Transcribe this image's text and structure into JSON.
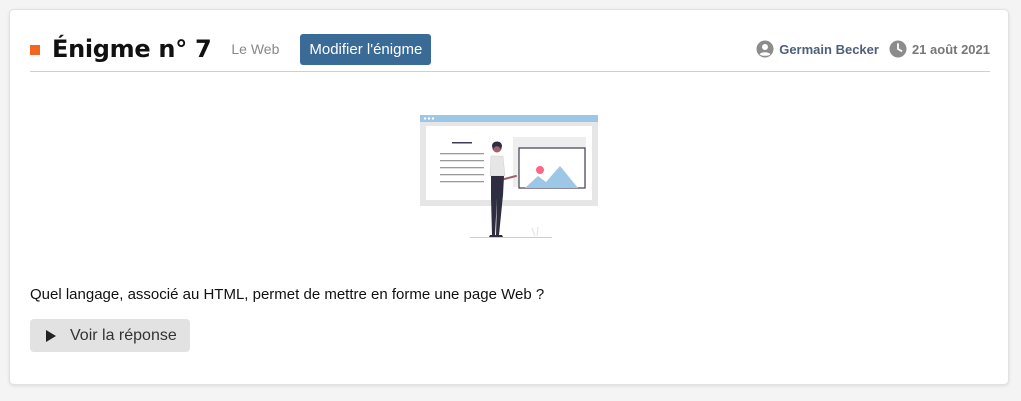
{
  "header": {
    "title": "Énigme n° 7",
    "category": "Le Web",
    "edit_label": "Modifier l'énigme",
    "author": "Germain Becker",
    "date": "21 août 2021",
    "accent_color": "#f26522",
    "button_color": "#3a6a96"
  },
  "icons": {
    "title_marker": "orange-square-icon",
    "author": "user-circle-icon",
    "date": "clock-icon",
    "answer": "play-icon",
    "illustration": "woman-presenting-web-page-illustration"
  },
  "content": {
    "question": "Quel langage, associé au HTML, permet de mettre en forme une page Web ?",
    "answer_label": "Voir la réponse"
  }
}
